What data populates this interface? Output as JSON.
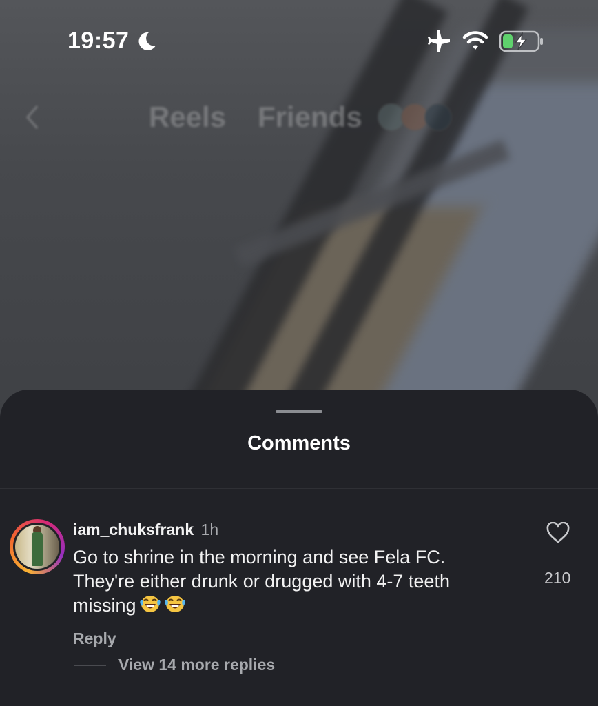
{
  "status_bar": {
    "time": "19:57",
    "icons": [
      "moon-icon",
      "airplane-icon",
      "wifi-icon",
      "battery-charging-icon"
    ],
    "battery_color": "#5fd16d"
  },
  "top_nav": {
    "tabs": [
      {
        "label": "Reels"
      },
      {
        "label": "Friends"
      }
    ],
    "back_icon": "chevron-left-icon"
  },
  "comments_sheet": {
    "title": "Comments",
    "comment": {
      "username": "iam_chuksfrank",
      "time_ago": "1h",
      "text": "Go to shrine in the morning and see Fela FC.\nThey're either drunk or drugged with 4-7 teeth missing",
      "emoji": [
        "face-with-tears-of-joy",
        "face-with-tears-of-joy"
      ],
      "like_count": "210",
      "reply_label": "Reply",
      "view_replies_label": "View 14 more replies"
    }
  },
  "colors": {
    "sheet_background": "#212227",
    "secondary_text": "#a7a9ad"
  }
}
